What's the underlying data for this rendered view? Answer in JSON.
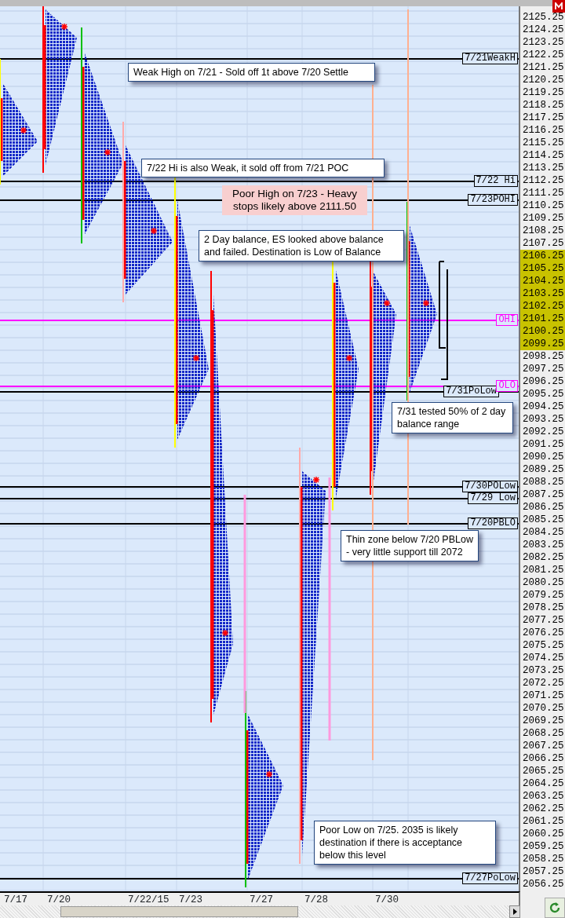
{
  "price_axis": [
    {
      "label": "2125.25",
      "highlighted": false
    },
    {
      "label": "2124.25",
      "highlighted": false
    },
    {
      "label": "2123.25",
      "highlighted": false
    },
    {
      "label": "2122.25",
      "highlighted": false
    },
    {
      "label": "2121.25",
      "highlighted": false
    },
    {
      "label": "2120.25",
      "highlighted": false
    },
    {
      "label": "2119.25",
      "highlighted": false
    },
    {
      "label": "2118.25",
      "highlighted": false
    },
    {
      "label": "2117.25",
      "highlighted": false
    },
    {
      "label": "2116.25",
      "highlighted": false
    },
    {
      "label": "2115.25",
      "highlighted": false
    },
    {
      "label": "2114.25",
      "highlighted": false
    },
    {
      "label": "2113.25",
      "highlighted": false
    },
    {
      "label": "2112.25",
      "highlighted": false
    },
    {
      "label": "2111.25",
      "highlighted": false
    },
    {
      "label": "2110.25",
      "highlighted": false
    },
    {
      "label": "2109.25",
      "highlighted": false
    },
    {
      "label": "2108.25",
      "highlighted": false
    },
    {
      "label": "2107.25",
      "highlighted": false
    },
    {
      "label": "2106.25",
      "highlighted": true
    },
    {
      "label": "2105.25",
      "highlighted": true
    },
    {
      "label": "2104.25",
      "highlighted": true
    },
    {
      "label": "2103.25",
      "highlighted": true
    },
    {
      "label": "2102.25",
      "highlighted": true
    },
    {
      "label": "2101.25",
      "highlighted": true
    },
    {
      "label": "2100.25",
      "highlighted": true
    },
    {
      "label": "2099.25",
      "highlighted": true
    },
    {
      "label": "2098.25",
      "highlighted": false
    },
    {
      "label": "2097.25",
      "highlighted": false
    },
    {
      "label": "2096.25",
      "highlighted": false
    },
    {
      "label": "2095.25",
      "highlighted": false
    },
    {
      "label": "2094.25",
      "highlighted": false
    },
    {
      "label": "2093.25",
      "highlighted": false
    },
    {
      "label": "2092.25",
      "highlighted": false
    },
    {
      "label": "2091.25",
      "highlighted": false
    },
    {
      "label": "2090.25",
      "highlighted": false
    },
    {
      "label": "2089.25",
      "highlighted": false
    },
    {
      "label": "2088.25",
      "highlighted": false
    },
    {
      "label": "2087.25",
      "highlighted": false
    },
    {
      "label": "2086.25",
      "highlighted": false
    },
    {
      "label": "2085.25",
      "highlighted": false
    },
    {
      "label": "2084.25",
      "highlighted": false
    },
    {
      "label": "2083.25",
      "highlighted": false
    },
    {
      "label": "2082.25",
      "highlighted": false
    },
    {
      "label": "2081.25",
      "highlighted": false
    },
    {
      "label": "2080.25",
      "highlighted": false
    },
    {
      "label": "2079.25",
      "highlighted": false
    },
    {
      "label": "2078.25",
      "highlighted": false
    },
    {
      "label": "2077.25",
      "highlighted": false
    },
    {
      "label": "2076.25",
      "highlighted": false
    },
    {
      "label": "2075.25",
      "highlighted": false
    },
    {
      "label": "2074.25",
      "highlighted": false
    },
    {
      "label": "2073.25",
      "highlighted": false
    },
    {
      "label": "2072.25",
      "highlighted": false
    },
    {
      "label": "2071.25",
      "highlighted": false
    },
    {
      "label": "2070.25",
      "highlighted": false
    },
    {
      "label": "2069.25",
      "highlighted": false
    },
    {
      "label": "2068.25",
      "highlighted": false
    },
    {
      "label": "2067.25",
      "highlighted": false
    },
    {
      "label": "2066.25",
      "highlighted": false
    },
    {
      "label": "2065.25",
      "highlighted": false
    },
    {
      "label": "2064.25",
      "highlighted": false
    },
    {
      "label": "2063.25",
      "highlighted": false
    },
    {
      "label": "2062.25",
      "highlighted": false
    },
    {
      "label": "2061.25",
      "highlighted": false
    },
    {
      "label": "2060.25",
      "highlighted": false
    },
    {
      "label": "2059.25",
      "highlighted": false
    },
    {
      "label": "2058.25",
      "highlighted": false
    },
    {
      "label": "2057.25",
      "highlighted": false
    },
    {
      "label": "2056.25",
      "highlighted": false
    }
  ],
  "date_axis": [
    "7/17",
    "7/20",
    "7/22/15",
    "7/23",
    "7/27",
    "7/28",
    "7/30"
  ],
  "level_labels": [
    {
      "text": "7/21WeakH",
      "color": "#000000"
    },
    {
      "text": "7/22 Hi",
      "color": "#000000"
    },
    {
      "text": "7/23POHI",
      "color": "#000000"
    },
    {
      "text": "OHI",
      "color": "#ff00ff"
    },
    {
      "text": "7/31PoLow",
      "color": "#000000"
    },
    {
      "text": "OLO",
      "color": "#ff00ff"
    },
    {
      "text": "7/30POLow",
      "color": "#000000"
    },
    {
      "text": "7/29 Low",
      "color": "#000000"
    },
    {
      "text": "7/20PBLO",
      "color": "#000000"
    },
    {
      "text": "7/27PoLow",
      "color": "#000000"
    }
  ],
  "callouts": [
    {
      "text": "Weak High on 7/21 - Sold off 1t above 7/20 Settle",
      "color": "#ffffff"
    },
    {
      "text": "7/22 Hi is also Weak, it sold off from 7/21 POC",
      "color": "#ffffff"
    },
    {
      "text": "Poor High on 7/23 - Heavy stops likely above 2111.50",
      "color": "#f8cfcf"
    },
    {
      "text": "2 Day balance, ES looked above balance and failed. Destination is Low of Balance",
      "color": "#ffffff"
    },
    {
      "text": "7/31 tested 50% of 2 day balance range",
      "color": "#ffffff"
    },
    {
      "text": "Thin zone below 7/20 PBLow - very little support till 2072",
      "color": "#ffffff"
    },
    {
      "text": "Poor Low on 7/25. 2035 is likely destination if there is acceptance below this level",
      "color": "#ffffff"
    }
  ]
}
